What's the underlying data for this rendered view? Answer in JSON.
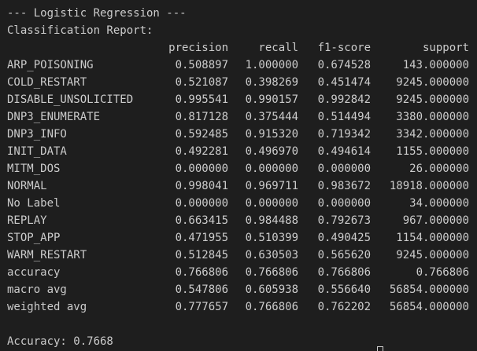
{
  "terminal": {
    "title_line": "--- Logistic Regression ---",
    "report_heading": "Classification Report:",
    "footer": "Accuracy: 0.7668"
  },
  "report": {
    "columns": [
      "",
      "precision",
      "recall",
      "f1-score",
      "support"
    ],
    "rows": [
      {
        "label": "ARP_POISONING",
        "precision": "0.508897",
        "recall": "1.000000",
        "f1": "0.674528",
        "support": "143.000000"
      },
      {
        "label": "COLD_RESTART",
        "precision": "0.521087",
        "recall": "0.398269",
        "f1": "0.451474",
        "support": "9245.000000"
      },
      {
        "label": "DISABLE_UNSOLICITED",
        "precision": "0.995541",
        "recall": "0.990157",
        "f1": "0.992842",
        "support": "9245.000000"
      },
      {
        "label": "DNP3_ENUMERATE",
        "precision": "0.817128",
        "recall": "0.375444",
        "f1": "0.514494",
        "support": "3380.000000"
      },
      {
        "label": "DNP3_INFO",
        "precision": "0.592485",
        "recall": "0.915320",
        "f1": "0.719342",
        "support": "3342.000000"
      },
      {
        "label": "INIT_DATA",
        "precision": "0.492281",
        "recall": "0.496970",
        "f1": "0.494614",
        "support": "1155.000000"
      },
      {
        "label": "MITM_DOS",
        "precision": "0.000000",
        "recall": "0.000000",
        "f1": "0.000000",
        "support": "26.000000"
      },
      {
        "label": "NORMAL",
        "precision": "0.998041",
        "recall": "0.969711",
        "f1": "0.983672",
        "support": "18918.000000"
      },
      {
        "label": "No Label",
        "precision": "0.000000",
        "recall": "0.000000",
        "f1": "0.000000",
        "support": "34.000000"
      },
      {
        "label": "REPLAY",
        "precision": "0.663415",
        "recall": "0.984488",
        "f1": "0.792673",
        "support": "967.000000"
      },
      {
        "label": "STOP_APP",
        "precision": "0.471955",
        "recall": "0.510399",
        "f1": "0.490425",
        "support": "1154.000000"
      },
      {
        "label": "WARM_RESTART",
        "precision": "0.512845",
        "recall": "0.630503",
        "f1": "0.565620",
        "support": "9245.000000"
      },
      {
        "label": "accuracy",
        "precision": "0.766806",
        "recall": "0.766806",
        "f1": "0.766806",
        "support": "0.766806"
      },
      {
        "label": "macro avg",
        "precision": "0.547806",
        "recall": "0.605938",
        "f1": "0.556640",
        "support": "56854.000000"
      },
      {
        "label": "weighted avg",
        "precision": "0.777657",
        "recall": "0.766806",
        "f1": "0.762202",
        "support": "56854.000000"
      }
    ]
  },
  "colors": {
    "background": "#1e1e1e",
    "foreground": "#cccccc"
  }
}
